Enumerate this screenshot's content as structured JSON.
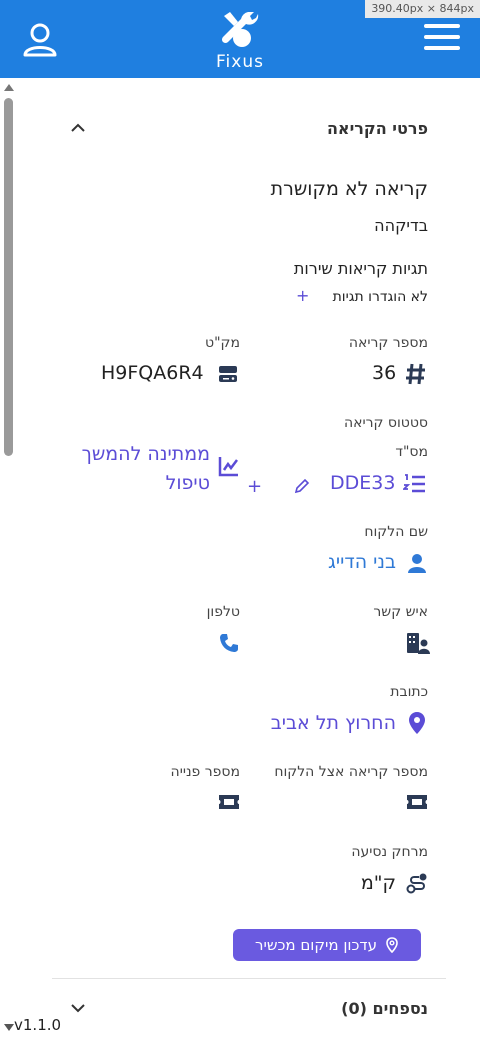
{
  "viewport_badge": "390.40px × 844px",
  "app": {
    "logo_text": "Fixus"
  },
  "section": {
    "title": "פרטי הקריאה",
    "call_title": "קריאה לא מקושרת",
    "call_subtitle": "בדיקהה",
    "tags_title": "תגיות קריאות שירות",
    "tags_empty": "לא הוגדרו תגיות",
    "tags_add": "+"
  },
  "fields": {
    "call_number_label": "מספר קריאה",
    "call_number_value": "36",
    "sku_label": "מק\"ט",
    "sku_value": "H9FQA6R4",
    "serial_label": "מס\"ד",
    "serial_value": "DDE33",
    "serial_add": "+",
    "status_label": "סטטוס קריאה",
    "status_value_line1": "ממתינה להמשך",
    "status_value_line2": "טיפול",
    "customer_label": "שם הלקוח",
    "customer_value": "בני הדייג",
    "contact_label": "איש קשר",
    "phone_label": "טלפון",
    "address_label": "כתובת",
    "address_value": "החרוץ תל אביב",
    "customer_call_number_label": "מספר קריאה אצל הלקוח",
    "request_number_label": "מספר פנייה",
    "travel_label": "מרחק נסיעה",
    "travel_value": "ק\"מ"
  },
  "update_location_button": "עדכון מיקום מכשיר",
  "attachments": {
    "title": "נספחים (0)"
  },
  "version": "v1.1.0",
  "colors": {
    "header": "#1f7fe0",
    "accent": "#6a5ae0",
    "link": "#2f79d6"
  }
}
